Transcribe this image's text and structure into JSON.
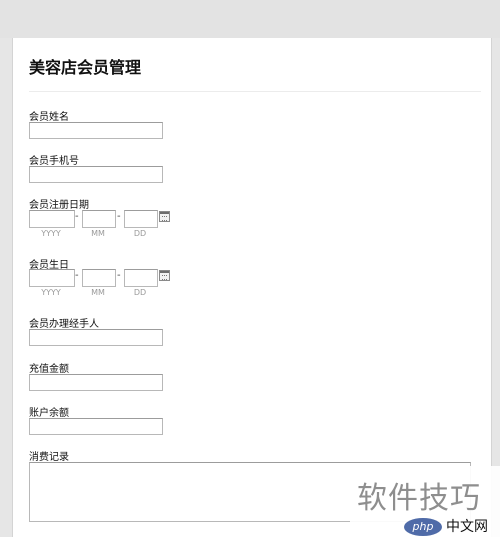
{
  "form": {
    "title": "美容店会员管理",
    "fields": {
      "name_label": "会员姓名",
      "phone_label": "会员手机号",
      "reg_date_label": "会员注册日期",
      "birthday_label": "会员生日",
      "agent_label": "会员办理经手人",
      "recharge_label": "充值金额",
      "balance_label": "账户余额",
      "history_label": "消费记录"
    },
    "date": {
      "separator": "-",
      "year_hint": "YYYY",
      "month_hint": "MM",
      "day_hint": "DD"
    }
  },
  "watermark": {
    "text": "软件技巧",
    "logo": "php",
    "site": "中文网"
  },
  "colors": {
    "page_bg": "#e6e6e6",
    "panel_bg": "#ffffff",
    "input_border": "#b8b8b8"
  }
}
